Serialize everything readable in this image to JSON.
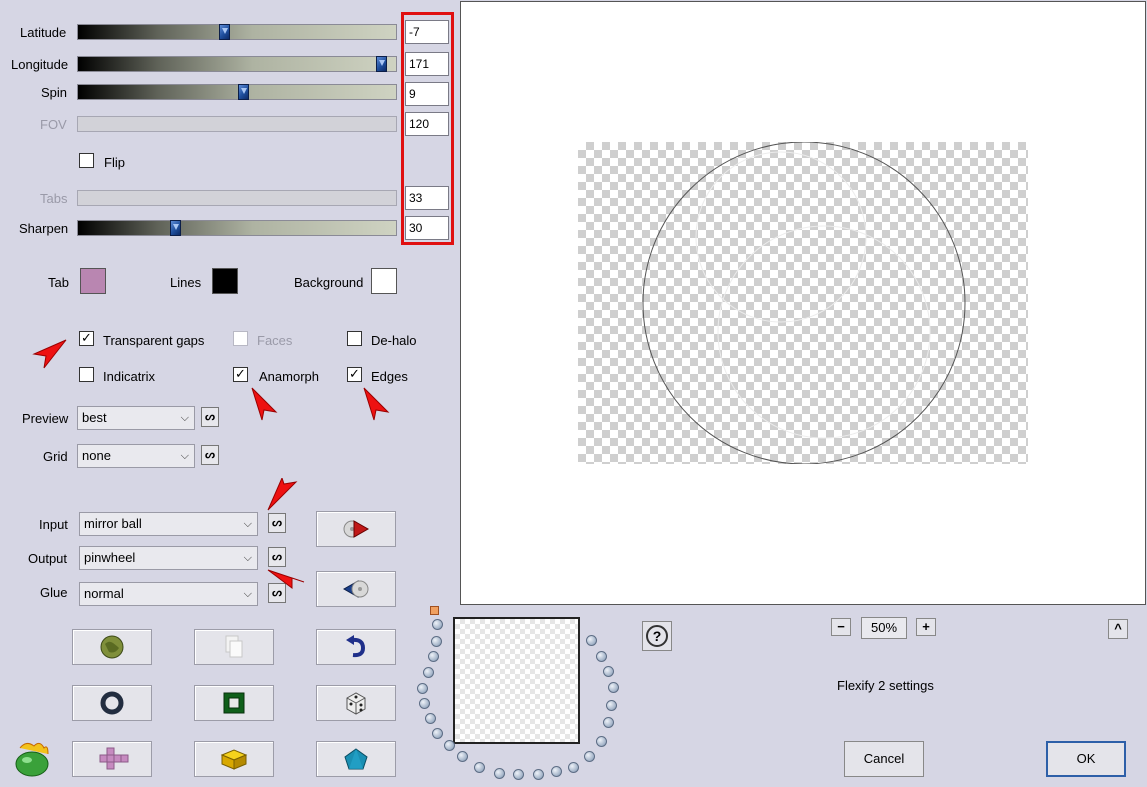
{
  "sliders": [
    {
      "label": "Latitude",
      "value": "-7",
      "position": 0.46,
      "enabled": true
    },
    {
      "label": "Longitude",
      "value": "171",
      "position": 0.95,
      "enabled": true
    },
    {
      "label": "Spin",
      "value": "9",
      "position": 0.52,
      "enabled": true
    },
    {
      "label": "FOV",
      "value": "120",
      "position": null,
      "enabled": false
    },
    {
      "label": "Tabs",
      "value": "33",
      "position": null,
      "enabled": false
    },
    {
      "label": "Sharpen",
      "value": "30",
      "position": 0.3,
      "enabled": true
    }
  ],
  "flip": {
    "label": "Flip",
    "checked": false
  },
  "colors": {
    "tab": {
      "label": "Tab",
      "color": "#b986b1"
    },
    "lines": {
      "label": "Lines",
      "color": "#000000"
    },
    "background": {
      "label": "Background",
      "color": "#ffffff"
    }
  },
  "options": {
    "transparent_gaps": {
      "label": "Transparent gaps",
      "checked": true
    },
    "faces": {
      "label": "Faces",
      "checked": false,
      "enabled": false
    },
    "de_halo": {
      "label": "De-halo",
      "checked": false
    },
    "indicatrix": {
      "label": "Indicatrix",
      "checked": false
    },
    "anamorph": {
      "label": "Anamorph",
      "checked": true
    },
    "edges": {
      "label": "Edges",
      "checked": true
    }
  },
  "dropdowns": {
    "preview": {
      "label": "Preview",
      "value": "best"
    },
    "grid": {
      "label": "Grid",
      "value": "none"
    },
    "input": {
      "label": "Input",
      "value": "mirror ball"
    },
    "output": {
      "label": "Output",
      "value": "pinwheel"
    },
    "glue": {
      "label": "Glue",
      "value": "normal"
    }
  },
  "small_button_glyph": "ᔕ",
  "zoom": {
    "minus": "−",
    "value": "50%",
    "plus": "+"
  },
  "help_glyph": "?",
  "collapse_glyph": "^",
  "status_text": "Flexify 2 settings",
  "buttons": {
    "cancel": "Cancel",
    "ok": "OK"
  },
  "accent": {
    "red_highlight": "#e01010",
    "arrow": "#ee1111"
  }
}
